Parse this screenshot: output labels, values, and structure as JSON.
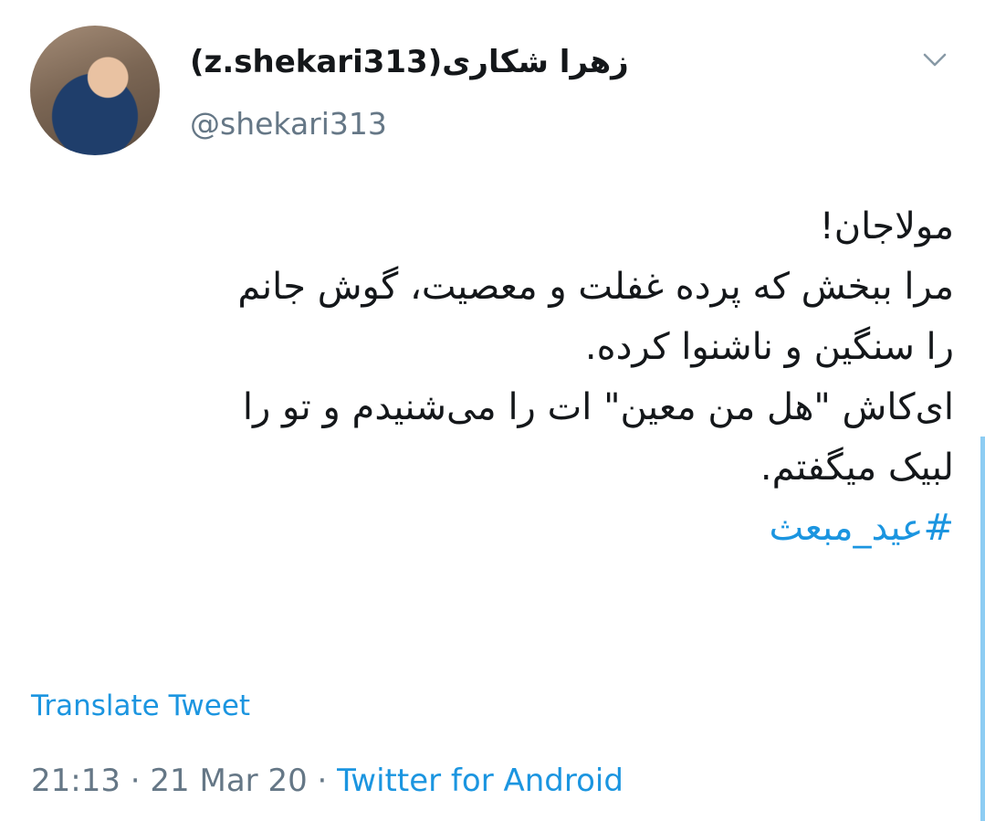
{
  "tweet": {
    "display_name": "زهرا شکاری(z.shekari313)",
    "handle": "@shekari313",
    "avatar_icon": "profile-avatar",
    "menu_icon": "chevron-down-icon",
    "body_lines": [
      "مولاجان!",
      "مرا ببخش که پرده غفلت و معصیت، گوش جانم",
      "را سنگین و ناشنوا کرده.",
      "ای‌کاش \"هل من معین\" ات را می‌شنیدم و تو را",
      "لبیک میگفتم."
    ],
    "hashtag": "#عید_مبعث",
    "translate_label": "Translate Tweet",
    "time": "21:13",
    "separator": " · ",
    "date": "21 Mar 20",
    "source": "Twitter for Android"
  },
  "colors": {
    "link": "#1b95e0",
    "text": "#14171a",
    "secondary": "#657786"
  }
}
